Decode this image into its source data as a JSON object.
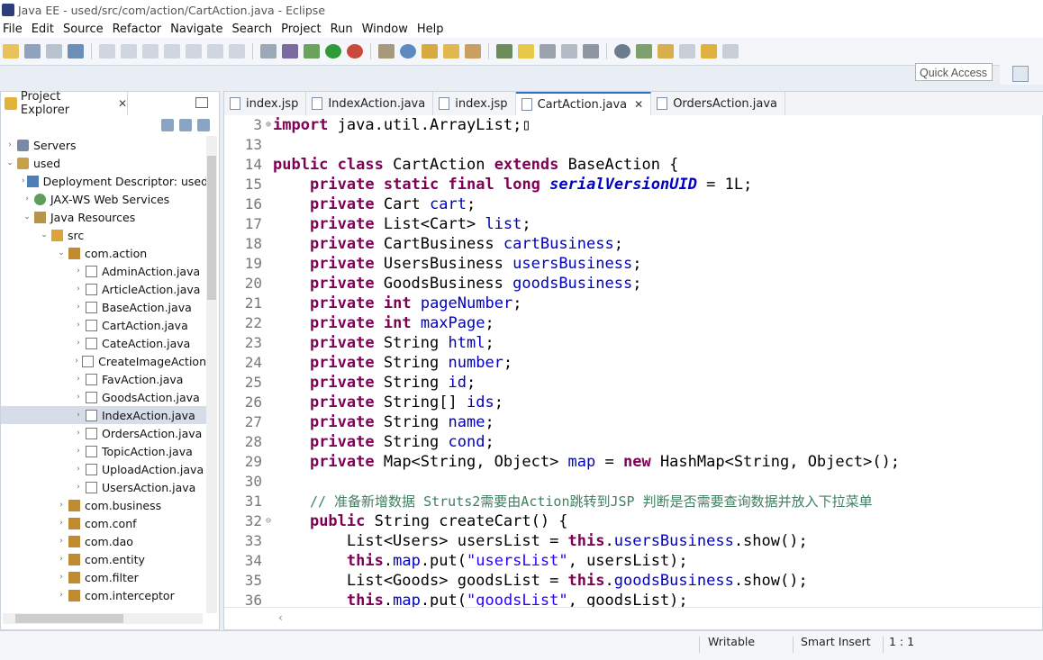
{
  "window": {
    "title": "Java EE - used/src/com/action/CartAction.java - Eclipse"
  },
  "menu": [
    "File",
    "Edit",
    "Source",
    "Refactor",
    "Navigate",
    "Search",
    "Project",
    "Run",
    "Window",
    "Help"
  ],
  "toolbar": {
    "quick_access": "Quick Access"
  },
  "explorer": {
    "tab_label": "Project Explorer",
    "tree": [
      {
        "label": "Servers",
        "depth": 0,
        "arrow": "›",
        "icon": "server"
      },
      {
        "label": "used",
        "depth": 0,
        "arrow": "⌄",
        "icon": "project"
      },
      {
        "label": "Deployment Descriptor: used",
        "depth": 1,
        "arrow": "›",
        "icon": "desc"
      },
      {
        "label": "JAX-WS Web Services",
        "depth": 1,
        "arrow": "›",
        "icon": "ws"
      },
      {
        "label": "Java Resources",
        "depth": 1,
        "arrow": "⌄",
        "icon": "res"
      },
      {
        "label": "src",
        "depth": 2,
        "arrow": "⌄",
        "icon": "src"
      },
      {
        "label": "com.action",
        "depth": 3,
        "arrow": "⌄",
        "icon": "pkg"
      },
      {
        "label": "AdminAction.java",
        "depth": 4,
        "arrow": "›",
        "icon": "java"
      },
      {
        "label": "ArticleAction.java",
        "depth": 4,
        "arrow": "›",
        "icon": "java"
      },
      {
        "label": "BaseAction.java",
        "depth": 4,
        "arrow": "›",
        "icon": "java"
      },
      {
        "label": "CartAction.java",
        "depth": 4,
        "arrow": "›",
        "icon": "java"
      },
      {
        "label": "CateAction.java",
        "depth": 4,
        "arrow": "›",
        "icon": "java"
      },
      {
        "label": "CreateImageAction",
        "depth": 4,
        "arrow": "›",
        "icon": "java"
      },
      {
        "label": "FavAction.java",
        "depth": 4,
        "arrow": "›",
        "icon": "java"
      },
      {
        "label": "GoodsAction.java",
        "depth": 4,
        "arrow": "›",
        "icon": "java"
      },
      {
        "label": "IndexAction.java",
        "depth": 4,
        "arrow": "›",
        "icon": "java",
        "selected": true
      },
      {
        "label": "OrdersAction.java",
        "depth": 4,
        "arrow": "›",
        "icon": "java"
      },
      {
        "label": "TopicAction.java",
        "depth": 4,
        "arrow": "›",
        "icon": "java"
      },
      {
        "label": "UploadAction.java",
        "depth": 4,
        "arrow": "›",
        "icon": "java"
      },
      {
        "label": "UsersAction.java",
        "depth": 4,
        "arrow": "›",
        "icon": "java"
      },
      {
        "label": "com.business",
        "depth": 3,
        "arrow": "›",
        "icon": "pkg"
      },
      {
        "label": "com.conf",
        "depth": 3,
        "arrow": "›",
        "icon": "pkg"
      },
      {
        "label": "com.dao",
        "depth": 3,
        "arrow": "›",
        "icon": "pkg"
      },
      {
        "label": "com.entity",
        "depth": 3,
        "arrow": "›",
        "icon": "pkg"
      },
      {
        "label": "com.filter",
        "depth": 3,
        "arrow": "›",
        "icon": "pkg"
      },
      {
        "label": "com.interceptor",
        "depth": 3,
        "arrow": "›",
        "icon": "pkg"
      }
    ]
  },
  "editor": {
    "tabs": [
      {
        "label": "index.jsp",
        "active": false
      },
      {
        "label": "IndexAction.java",
        "active": false
      },
      {
        "label": "index.jsp",
        "active": false
      },
      {
        "label": "CartAction.java",
        "active": true
      },
      {
        "label": "OrdersAction.java",
        "active": false
      }
    ],
    "lines": [
      {
        "n": "3",
        "fold": "⊕",
        "tokens": [
          [
            "kw",
            "import"
          ],
          [
            "txt",
            " java.util.ArrayList;"
          ],
          [
            "txt",
            "▯"
          ]
        ]
      },
      {
        "n": "13",
        "fold": "",
        "tokens": []
      },
      {
        "n": "14",
        "fold": "",
        "tokens": [
          [
            "kw",
            "public"
          ],
          [
            "txt",
            " "
          ],
          [
            "kw",
            "class"
          ],
          [
            "txt",
            " CartAction "
          ],
          [
            "kw",
            "extends"
          ],
          [
            "txt",
            " BaseAction {"
          ]
        ]
      },
      {
        "n": "15",
        "fold": "",
        "tokens": [
          [
            "txt",
            "    "
          ],
          [
            "kw",
            "private"
          ],
          [
            "txt",
            " "
          ],
          [
            "kw",
            "static"
          ],
          [
            "txt",
            " "
          ],
          [
            "kw",
            "final"
          ],
          [
            "txt",
            " "
          ],
          [
            "kw",
            "long"
          ],
          [
            "txt",
            " "
          ],
          [
            "sfld",
            "serialVersionUID"
          ],
          [
            "txt",
            " = 1L;"
          ]
        ]
      },
      {
        "n": "16",
        "fold": "",
        "tokens": [
          [
            "txt",
            "    "
          ],
          [
            "kw",
            "private"
          ],
          [
            "txt",
            " Cart "
          ],
          [
            "fld",
            "cart"
          ],
          [
            "txt",
            ";"
          ]
        ]
      },
      {
        "n": "17",
        "fold": "",
        "tokens": [
          [
            "txt",
            "    "
          ],
          [
            "kw",
            "private"
          ],
          [
            "txt",
            " List<Cart> "
          ],
          [
            "fld",
            "list"
          ],
          [
            "txt",
            ";"
          ]
        ]
      },
      {
        "n": "18",
        "fold": "",
        "tokens": [
          [
            "txt",
            "    "
          ],
          [
            "kw",
            "private"
          ],
          [
            "txt",
            " CartBusiness "
          ],
          [
            "fld",
            "cartBusiness"
          ],
          [
            "txt",
            ";"
          ]
        ]
      },
      {
        "n": "19",
        "fold": "",
        "tokens": [
          [
            "txt",
            "    "
          ],
          [
            "kw",
            "private"
          ],
          [
            "txt",
            " UsersBusiness "
          ],
          [
            "fld",
            "usersBusiness"
          ],
          [
            "txt",
            ";"
          ]
        ]
      },
      {
        "n": "20",
        "fold": "",
        "tokens": [
          [
            "txt",
            "    "
          ],
          [
            "kw",
            "private"
          ],
          [
            "txt",
            " GoodsBusiness "
          ],
          [
            "fld",
            "goodsBusiness"
          ],
          [
            "txt",
            ";"
          ]
        ]
      },
      {
        "n": "21",
        "fold": "",
        "tokens": [
          [
            "txt",
            "    "
          ],
          [
            "kw",
            "private"
          ],
          [
            "txt",
            " "
          ],
          [
            "kw",
            "int"
          ],
          [
            "txt",
            " "
          ],
          [
            "fld",
            "pageNumber"
          ],
          [
            "txt",
            ";"
          ]
        ]
      },
      {
        "n": "22",
        "fold": "",
        "tokens": [
          [
            "txt",
            "    "
          ],
          [
            "kw",
            "private"
          ],
          [
            "txt",
            " "
          ],
          [
            "kw",
            "int"
          ],
          [
            "txt",
            " "
          ],
          [
            "fld",
            "maxPage"
          ],
          [
            "txt",
            ";"
          ]
        ]
      },
      {
        "n": "23",
        "fold": "",
        "tokens": [
          [
            "txt",
            "    "
          ],
          [
            "kw",
            "private"
          ],
          [
            "txt",
            " String "
          ],
          [
            "fld",
            "html"
          ],
          [
            "txt",
            ";"
          ]
        ]
      },
      {
        "n": "24",
        "fold": "",
        "tokens": [
          [
            "txt",
            "    "
          ],
          [
            "kw",
            "private"
          ],
          [
            "txt",
            " String "
          ],
          [
            "fld",
            "number"
          ],
          [
            "txt",
            ";"
          ]
        ]
      },
      {
        "n": "25",
        "fold": "",
        "tokens": [
          [
            "txt",
            "    "
          ],
          [
            "kw",
            "private"
          ],
          [
            "txt",
            " String "
          ],
          [
            "fld",
            "id"
          ],
          [
            "txt",
            ";"
          ]
        ]
      },
      {
        "n": "26",
        "fold": "",
        "tokens": [
          [
            "txt",
            "    "
          ],
          [
            "kw",
            "private"
          ],
          [
            "txt",
            " String[] "
          ],
          [
            "fld",
            "ids"
          ],
          [
            "txt",
            ";"
          ]
        ]
      },
      {
        "n": "27",
        "fold": "",
        "tokens": [
          [
            "txt",
            "    "
          ],
          [
            "kw",
            "private"
          ],
          [
            "txt",
            " String "
          ],
          [
            "fld",
            "name"
          ],
          [
            "txt",
            ";"
          ]
        ]
      },
      {
        "n": "28",
        "fold": "",
        "tokens": [
          [
            "txt",
            "    "
          ],
          [
            "kw",
            "private"
          ],
          [
            "txt",
            " String "
          ],
          [
            "fld",
            "cond"
          ],
          [
            "txt",
            ";"
          ]
        ]
      },
      {
        "n": "29",
        "fold": "",
        "tokens": [
          [
            "txt",
            "    "
          ],
          [
            "kw",
            "private"
          ],
          [
            "txt",
            " Map<String, Object> "
          ],
          [
            "fld",
            "map"
          ],
          [
            "txt",
            " = "
          ],
          [
            "kw",
            "new"
          ],
          [
            "txt",
            " HashMap<String, Object>();"
          ]
        ]
      },
      {
        "n": "30",
        "fold": "",
        "tokens": []
      },
      {
        "n": "31",
        "fold": "",
        "tokens": [
          [
            "txt",
            "    "
          ],
          [
            "cmt",
            "// 准备新增数据 Struts2需要由Action跳转到JSP 判断是否需要查询数据并放入下拉菜单"
          ]
        ]
      },
      {
        "n": "32",
        "fold": "⊖",
        "tokens": [
          [
            "txt",
            "    "
          ],
          [
            "kw",
            "public"
          ],
          [
            "txt",
            " String createCart() {"
          ]
        ]
      },
      {
        "n": "33",
        "fold": "",
        "tokens": [
          [
            "txt",
            "        List<Users> "
          ],
          [
            "txt",
            "usersList"
          ],
          [
            "txt",
            " = "
          ],
          [
            "kw",
            "this"
          ],
          [
            "txt",
            "."
          ],
          [
            "fld",
            "usersBusiness"
          ],
          [
            "txt",
            ".show();"
          ]
        ]
      },
      {
        "n": "34",
        "fold": "",
        "tokens": [
          [
            "txt",
            "        "
          ],
          [
            "kw",
            "this"
          ],
          [
            "txt",
            "."
          ],
          [
            "fld",
            "map"
          ],
          [
            "txt",
            ".put("
          ],
          [
            "str",
            "\"usersList\""
          ],
          [
            "txt",
            ", usersList);"
          ]
        ]
      },
      {
        "n": "35",
        "fold": "",
        "tokens": [
          [
            "txt",
            "        List<Goods> "
          ],
          [
            "txt",
            "goodsList"
          ],
          [
            "txt",
            " = "
          ],
          [
            "kw",
            "this"
          ],
          [
            "txt",
            "."
          ],
          [
            "fld",
            "goodsBusiness"
          ],
          [
            "txt",
            ".show();"
          ]
        ]
      },
      {
        "n": "36",
        "fold": "",
        "tokens": [
          [
            "txt",
            "        "
          ],
          [
            "kw",
            "this"
          ],
          [
            "txt",
            "."
          ],
          [
            "fld",
            "map"
          ],
          [
            "txt",
            ".put("
          ],
          [
            "str",
            "\"goodsList\""
          ],
          [
            "txt",
            ", goodsList);"
          ]
        ]
      }
    ]
  },
  "status": {
    "writable": "Writable",
    "insert_mode": "Smart Insert",
    "position": "1 : 1"
  },
  "colors": {
    "keyword": "#7f0055",
    "field": "#0000c0",
    "string": "#2a00ff",
    "comment": "#3f7f5f",
    "active_tab": "#2e6fd0"
  }
}
